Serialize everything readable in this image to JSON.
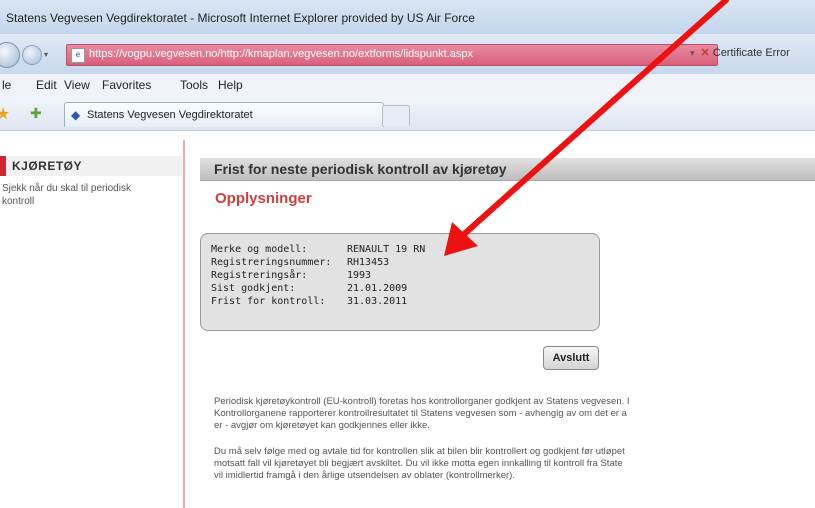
{
  "browser": {
    "title": "Statens Vegvesen Vegdirektoratet - Microsoft Internet Explorer provided by US Air Force",
    "url": "https://vogpu.vegvesen.no/http://kmaplan.vegvesen.no/extforms/lidspunkt.aspx",
    "certificate_label": "Certificate Error",
    "menu": [
      "le",
      "Edit",
      "View",
      "Favorites",
      "Tools",
      "Help"
    ],
    "tab_label": "Statens Vegvesen Vegdirektoratet"
  },
  "sidebar": {
    "header": "KJØRETØY",
    "link": "Sjekk når du skal til periodisk kontroll"
  },
  "main": {
    "bar_title": "Frist for neste periodisk kontroll av kjøretøy",
    "subtitle": "Opplysninger",
    "info_rows": [
      {
        "label": "Merke og modell:",
        "value": "RENAULT 19 RN"
      },
      {
        "label": "Registreringsnummer:",
        "value": "RH13453"
      },
      {
        "label": "Registreringsår:",
        "value": "1993"
      },
      {
        "label": "Sist godkjent:",
        "value": "21.01.2009"
      },
      {
        "label": "Frist for kontroll:",
        "value": "31.03.2011"
      }
    ],
    "button_label": "Avslutt",
    "paragraph1": [
      "Periodisk kjøretøykontroll (EU-kontroll) foretas hos kontrollorganer godkjent av Statens vegvesen. I",
      "Kontrollorganene rapporterer kontrollresultatet til Statens vegvesen som - avhengig av om det er a",
      "er - avgjør om kjøretøyet kan godkjennes eller ikke."
    ],
    "paragraph2": [
      "Du må selv følge med og avtale tid for kontrollen slik at bilen blir kontrollert og godkjent før utløpet",
      "motsatt fall vil kjøretøyet bli begjært avskiltet. Du vil ikke motta egen innkalling til kontroll fra State",
      "vil imidlertid framgå i den årlige utsendelsen av oblater (kontrollmerker)."
    ]
  },
  "colors": {
    "accent_red": "#cc2a36",
    "annotation_arrow": "#ee1111",
    "address_bar_error": "#d9607c"
  }
}
